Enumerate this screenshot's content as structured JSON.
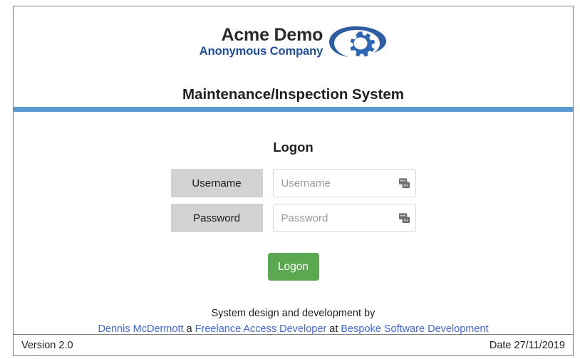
{
  "header": {
    "brand_line1": "Acme Demo",
    "brand_line2": "Anonymous Company",
    "logo_icon": "gear-swoosh-logo-icon",
    "app_title": "Maintenance/Inspection System",
    "brand_text_color": "#2b2b2b",
    "brand_accent_color": "#1f4e9c",
    "rule_color": "#5b9bd5"
  },
  "main": {
    "heading": "Logon",
    "fields": [
      {
        "label": "Username",
        "value": "",
        "placeholder": "Username",
        "icon": "scan-card-icon",
        "type": "text"
      },
      {
        "label": "Password",
        "value": "",
        "placeholder": "Password",
        "icon": "scan-card-icon",
        "type": "text"
      }
    ],
    "submit_label": "Logon",
    "submit_color": "#5aa84f"
  },
  "credits": {
    "line1": "System design and development by",
    "author": "Dennis McDermott",
    "connector1": "a",
    "role": "Freelance Access Developer",
    "connector2": "at",
    "company": "Bespoke Software Development",
    "link_color": "#4169d8"
  },
  "status": {
    "version": "Version 2.0",
    "date": "Date 27/11/2019"
  }
}
